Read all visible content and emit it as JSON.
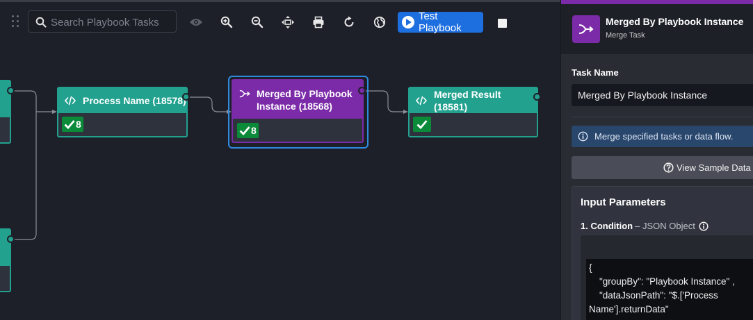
{
  "toolbar": {
    "search_placeholder": "Search Playbook Tasks",
    "test_button_label": "Test Playbook",
    "icons": [
      "drag-grip-icon",
      "search-icon",
      "eye-icon",
      "zoom-in-icon",
      "zoom-out-icon",
      "fit-to-screen-icon",
      "print-icon",
      "refresh-icon",
      "globe-icon",
      "play-icon",
      "stop-icon"
    ]
  },
  "nodes": [
    {
      "id": "process-name",
      "title": "Process Name (18578)",
      "status_count": "8",
      "color": "#23a18f"
    },
    {
      "id": "merged-by-playbook",
      "title_line1": "Merged By Playbook",
      "title_line2": "Instance (18568)",
      "status_count": "8",
      "color": "#7b2ba8",
      "selected": true
    },
    {
      "id": "merged-result",
      "title": "Merged Result (18581)",
      "status_count": "",
      "color": "#23a18f"
    }
  ],
  "panel": {
    "title": "Merged By Playbook Instance",
    "subtitle": "Merge Task",
    "task_name_label": "Task Name",
    "task_name_value": "Merged By Playbook Instance",
    "info_text": "Merge specified tasks or data flow.",
    "sample_button_label": "View Sample Data",
    "input_params_heading": "Input Parameters",
    "condition_label": "1. Condition",
    "condition_type": "– JSON Object",
    "code": "{\n    \"groupBy\": \"Playbook Instance\" ,\n    \"dataJsonPath\": \"$.['Process\nName'].returnData\""
  },
  "colors": {
    "accent_purple": "#7b2ba8",
    "accent_teal": "#23a18f",
    "primary_blue": "#1d6fe0",
    "success_green": "#0b8a3a",
    "info_blue": "#29466d"
  }
}
